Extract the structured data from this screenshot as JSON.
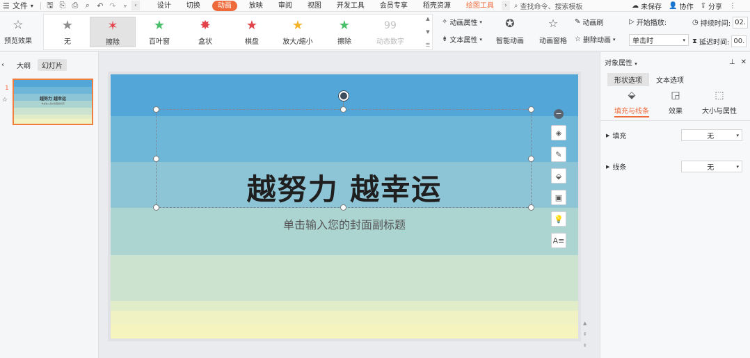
{
  "menubar": {
    "file_label": "文件",
    "tabs": [
      "设计",
      "切换",
      "动画",
      "放映",
      "审阅",
      "视图",
      "开发工具",
      "会员专享",
      "稻壳资源"
    ],
    "active_tab": "动画",
    "contextual_tab": "绘图工具",
    "search_placeholder": "查找命令、搜索模板",
    "unsaved_label": "未保存",
    "collab_label": "协作",
    "share_label": "分享"
  },
  "ribbon": {
    "preview_label": "预览效果",
    "gallery": [
      {
        "label": "无",
        "icon": "star-gray-icon",
        "color": "#8e8e8e"
      },
      {
        "label": "擦除",
        "icon": "star-red-icon",
        "color": "#e2424a"
      },
      {
        "label": "百叶窗",
        "icon": "star-green-icon",
        "color": "#4bbf6b"
      },
      {
        "label": "盒状",
        "icon": "star-red-icon",
        "color": "#e2424a"
      },
      {
        "label": "棋盘",
        "icon": "star-red-icon",
        "color": "#e2424a"
      },
      {
        "label": "放大/缩小",
        "icon": "star-yellow-icon",
        "color": "#f3b32a"
      },
      {
        "label": "擦除",
        "icon": "star-green-icon",
        "color": "#4bbf6b"
      },
      {
        "label": "动态数字",
        "icon": "digits-icon",
        "color": "#b7b7b7"
      }
    ],
    "anim_props_label": "动画属性",
    "text_props_label": "文本属性",
    "smart_anim_label": "智能动画",
    "anim_pane_label": "动画窗格",
    "anim_brush_label": "动画刷",
    "delete_anim_label": "删除动画",
    "start_play_label": "开始播放:",
    "start_play_value": "单击时",
    "duration_label": "持续时间:",
    "duration_value": "02.",
    "delay_label": "延迟时间:",
    "delay_value": "00."
  },
  "leftpanel": {
    "outline_tab": "大纲",
    "slides_tab": "幻灯片",
    "slide_number": "1",
    "thumb_title": "越努力 越幸运",
    "thumb_sub": "单击输入您的封面副标题"
  },
  "slide": {
    "title": "越努力 越幸运",
    "subtitle": "单击输入您的封面副标题",
    "bands": [
      "#52a7d8",
      "#6fb7d8",
      "#8ec5d6",
      "#acd5d2",
      "#cbe3cf",
      "#e1ecc9",
      "#f1f2c4",
      "#f5f3be"
    ]
  },
  "rightpanel": {
    "title": "对象属性",
    "tab_shape": "形状选项",
    "tab_text": "文本选项",
    "sub_fill_line": "填充与线条",
    "sub_effect": "效果",
    "sub_size": "大小与属性",
    "fill_label": "填充",
    "fill_value": "无",
    "line_label": "线条",
    "line_value": "无"
  }
}
